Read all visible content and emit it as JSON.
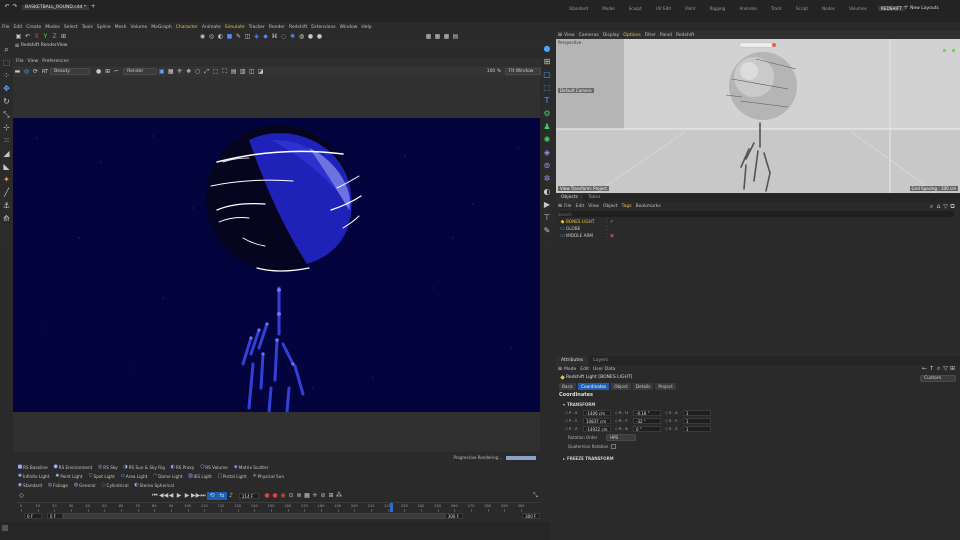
{
  "titlebar": {
    "file_tab": "BASKETBALL_ROUND.c4d *",
    "workspaces": [
      "Standard",
      "Model",
      "Sculpt",
      "UV Edit",
      "Paint",
      "Rigging",
      "Animate",
      "Track",
      "Script",
      "Nodes",
      "Volumes",
      "REDSHIFT"
    ],
    "layout_label": "New Layouts"
  },
  "menubar": [
    "File",
    "Edit",
    "Create",
    "Modes",
    "Select",
    "Tools",
    "Spline",
    "Mesh",
    "Volume",
    "MoGraph",
    "Character",
    "Animate",
    "Simulate",
    "Tracker",
    "Render",
    "Redshift",
    "Extensions",
    "Window",
    "Help"
  ],
  "renderview": {
    "title": "Redshift RenderView",
    "menu": [
      "File",
      "View",
      "Preferences"
    ],
    "channel": "Beauty",
    "mode": "Render",
    "zoom": "100 %",
    "fit_label": "Fit Window",
    "status_text": "Progressive Rendering..."
  },
  "shelf": {
    "row1": [
      "RS Baseline",
      "RS Environment",
      "RS Sky",
      "RS Sun & Sky Rig",
      "RS Proxy",
      "RS Volume",
      "Matrix Scatter"
    ],
    "row2": [
      "Infinite Light",
      "Point Light",
      "Spot Light",
      "Area Light",
      "Dome Light",
      "IES Light",
      "Portal Light",
      "Physical Sun"
    ],
    "row3": [
      "Standard",
      "Foliage",
      "General",
      "Cylindrical",
      "Stereo Spherical"
    ]
  },
  "timeline": {
    "current_frame": "214 F",
    "ticks": [
      "0",
      "10",
      "20",
      "30",
      "40",
      "50",
      "60",
      "70",
      "80",
      "90",
      "100",
      "110",
      "120",
      "130",
      "140",
      "150",
      "160",
      "170",
      "180",
      "190",
      "200",
      "210",
      "220",
      "230",
      "240",
      "250",
      "260",
      "270",
      "280",
      "290",
      "300"
    ],
    "start": "0 F",
    "start2": "0 F",
    "end": "300 F",
    "end2": "300 F"
  },
  "viewport": {
    "menu": [
      "View",
      "Cameras",
      "Display",
      "Options",
      "Filter",
      "Panel",
      "Redshift"
    ],
    "top_label": "Perspective",
    "camera_label": "Default Camera",
    "bottom_label": "View Transform: Project",
    "grid_label": "Grid Spacing : 100 cm"
  },
  "objects": {
    "tabs": [
      "Objects",
      "Takes"
    ],
    "menu": [
      "File",
      "Edit",
      "View",
      "Object",
      "Tags",
      "Bookmarks"
    ],
    "search_placeholder": "Search",
    "items": [
      "BONES LIGHT",
      "GLOBE",
      "MIDDLE ARM"
    ]
  },
  "attributes": {
    "tabs": [
      "Attributes",
      "Layers"
    ],
    "menu": [
      "Mode",
      "Edit",
      "User Data"
    ],
    "mode_select": "Custom",
    "object_title": "Redshift Light [BONES LIGHT]",
    "subtabs": [
      "Basic",
      "Coordinates",
      "Object",
      "Details",
      "Project"
    ],
    "section": "Coordinates",
    "group": "TRANSFORM",
    "rows": [
      {
        "p_label": "P . X",
        "p": "-1406 cm",
        "r_label": "R . H",
        "r": "-0.18 °",
        "s_label": "S . X",
        "s": "1"
      },
      {
        "p_label": "P . Y",
        "p": "10837 cm",
        "r_label": "R . P",
        "r": "-32 °",
        "s_label": "S . Y",
        "s": "1"
      },
      {
        "p_label": "P . Z",
        "p": "-14922 cm",
        "r_label": "R . B",
        "r": "0 °",
        "s_label": "S . Z",
        "s": "1"
      }
    ],
    "rotation_order_label": "Rotation Order",
    "rotation_order": "HPB",
    "quaternion_label": "Quaternion Rotation",
    "freeze": "FREEZE TRANSFORM"
  },
  "colors": {
    "accent": "#1d7dd6",
    "render_bg": "#03043d",
    "sphere": "#1f22b8"
  }
}
